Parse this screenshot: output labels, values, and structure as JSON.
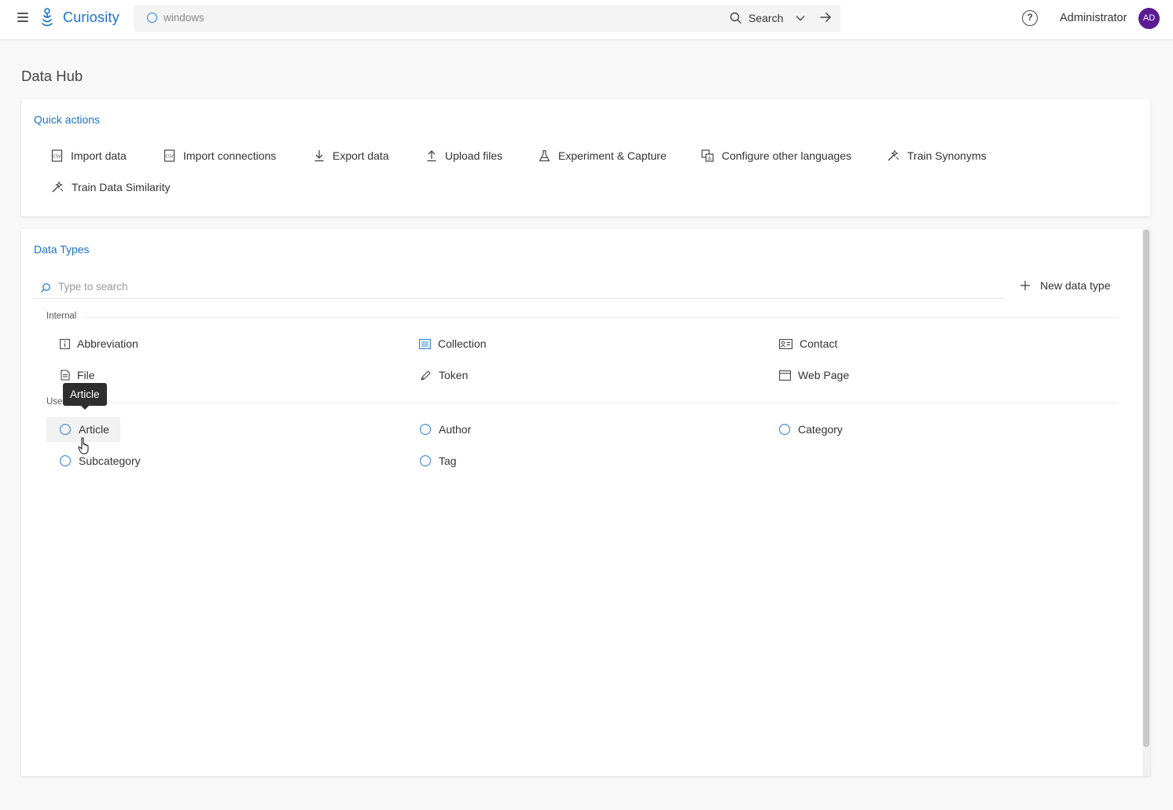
{
  "header": {
    "app_name": "Curiosity",
    "search_query": "windows",
    "search_label": "Search",
    "help_glyph": "?",
    "user_name": "Administrator",
    "avatar_initials": "AD",
    "brand_color": "#1a73c9",
    "avatar_color": "#5b1c93"
  },
  "page": {
    "title": "Data Hub"
  },
  "quick_actions": {
    "title": "Quick actions",
    "items": [
      {
        "label": "Import data",
        "icon": "csv-file-icon"
      },
      {
        "label": "Import connections",
        "icon": "csv-file-icon"
      },
      {
        "label": "Export data",
        "icon": "download-icon"
      },
      {
        "label": "Upload files",
        "icon": "upload-icon"
      },
      {
        "label": "Experiment & Capture",
        "icon": "flask-icon"
      },
      {
        "label": "Configure other languages",
        "icon": "translate-icon"
      },
      {
        "label": "Train Synonyms",
        "icon": "wand-icon"
      },
      {
        "label": "Train Data Similarity",
        "icon": "wand-icon"
      }
    ]
  },
  "data_types": {
    "title": "Data Types",
    "search_placeholder": "Type to search",
    "new_type_label": "New data type",
    "internal": {
      "label": "Internal",
      "items": [
        {
          "label": "Abbreviation",
          "icon": "info-box-icon"
        },
        {
          "label": "Collection",
          "icon": "list-icon"
        },
        {
          "label": "Contact",
          "icon": "contact-card-icon"
        },
        {
          "label": "File",
          "icon": "document-icon"
        },
        {
          "label": "Token",
          "icon": "pen-icon"
        },
        {
          "label": "Web Page",
          "icon": "browser-window-icon"
        }
      ]
    },
    "user": {
      "label": "User",
      "items": [
        {
          "label": "Article",
          "icon": "circle-icon"
        },
        {
          "label": "Author",
          "icon": "circle-icon"
        },
        {
          "label": "Category",
          "icon": "circle-icon"
        },
        {
          "label": "Subcategory",
          "icon": "circle-icon"
        },
        {
          "label": "Tag",
          "icon": "circle-icon"
        }
      ]
    }
  },
  "tooltip": {
    "text": "Article"
  }
}
